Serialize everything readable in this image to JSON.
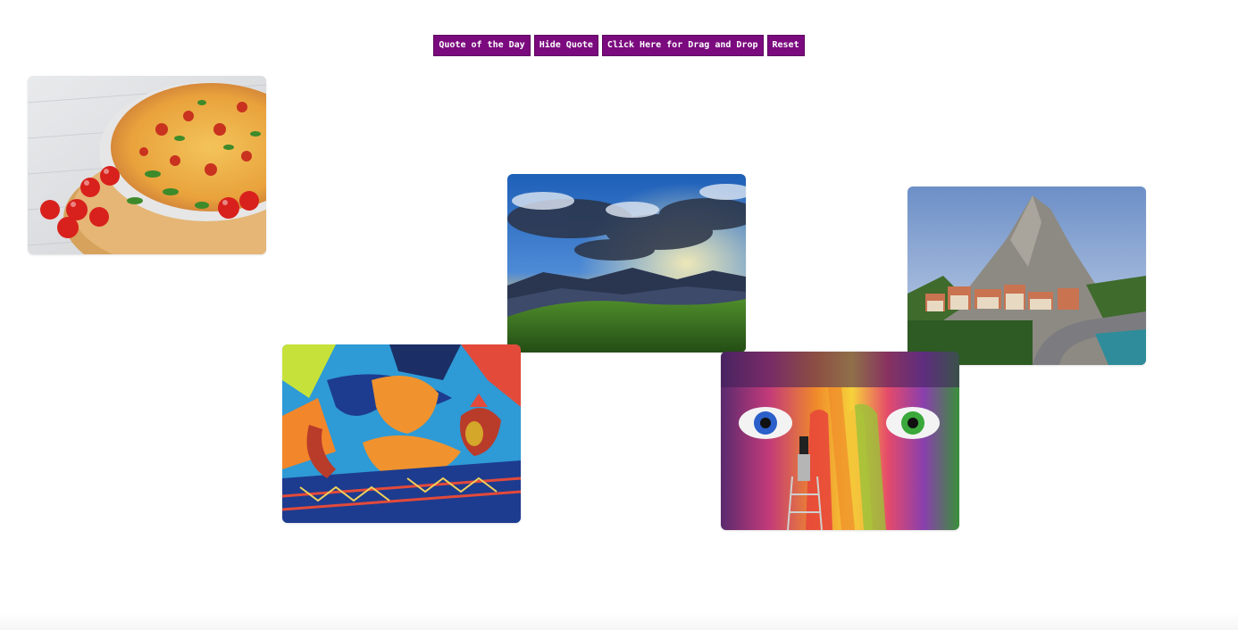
{
  "toolbar": {
    "buttons": [
      {
        "label": "Quote of the Day"
      },
      {
        "label": "Hide Quote"
      },
      {
        "label": "Click Here for Drag and Drop"
      },
      {
        "label": "Reset"
      }
    ],
    "button_color": "#7a0a7e",
    "button_text_color": "#ffffff"
  },
  "gallery": {
    "images": [
      {
        "subject": "pizza"
      },
      {
        "subject": "sunset-sky"
      },
      {
        "subject": "mountain-village"
      },
      {
        "subject": "mural"
      },
      {
        "subject": "painted-face"
      }
    ]
  }
}
